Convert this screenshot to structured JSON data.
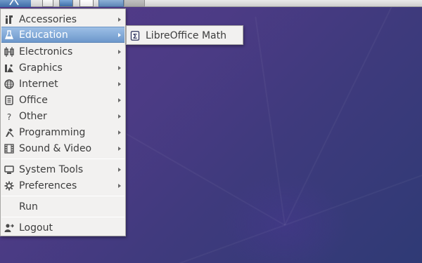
{
  "menu": {
    "items": [
      {
        "label": "Accessories",
        "icon": "accessories-icon",
        "has_submenu": true
      },
      {
        "label": "Education",
        "icon": "education-icon",
        "has_submenu": true,
        "active": true
      },
      {
        "label": "Electronics",
        "icon": "electronics-icon",
        "has_submenu": true
      },
      {
        "label": "Graphics",
        "icon": "graphics-icon",
        "has_submenu": true
      },
      {
        "label": "Internet",
        "icon": "internet-icon",
        "has_submenu": true
      },
      {
        "label": "Office",
        "icon": "office-icon",
        "has_submenu": true
      },
      {
        "label": "Other",
        "icon": "question-icon",
        "has_submenu": true
      },
      {
        "label": "Programming",
        "icon": "programming-icon",
        "has_submenu": true
      },
      {
        "label": "Sound & Video",
        "icon": "film-icon",
        "has_submenu": true
      },
      {
        "label": "System Tools",
        "icon": "monitor-icon",
        "has_submenu": true
      },
      {
        "label": "Preferences",
        "icon": "gear-icon",
        "has_submenu": true
      },
      {
        "label": "Run",
        "icon": "",
        "has_submenu": false
      },
      {
        "label": "Logout",
        "icon": "logout-icon",
        "has_submenu": false
      }
    ]
  },
  "submenu": {
    "items": [
      {
        "label": "LibreOffice Math",
        "icon": "libreoffice-math-icon"
      }
    ]
  },
  "colors": {
    "highlight": "#7fa6d6",
    "menu_bg": "#f2f1f0",
    "desktop": "#4c3b85"
  }
}
